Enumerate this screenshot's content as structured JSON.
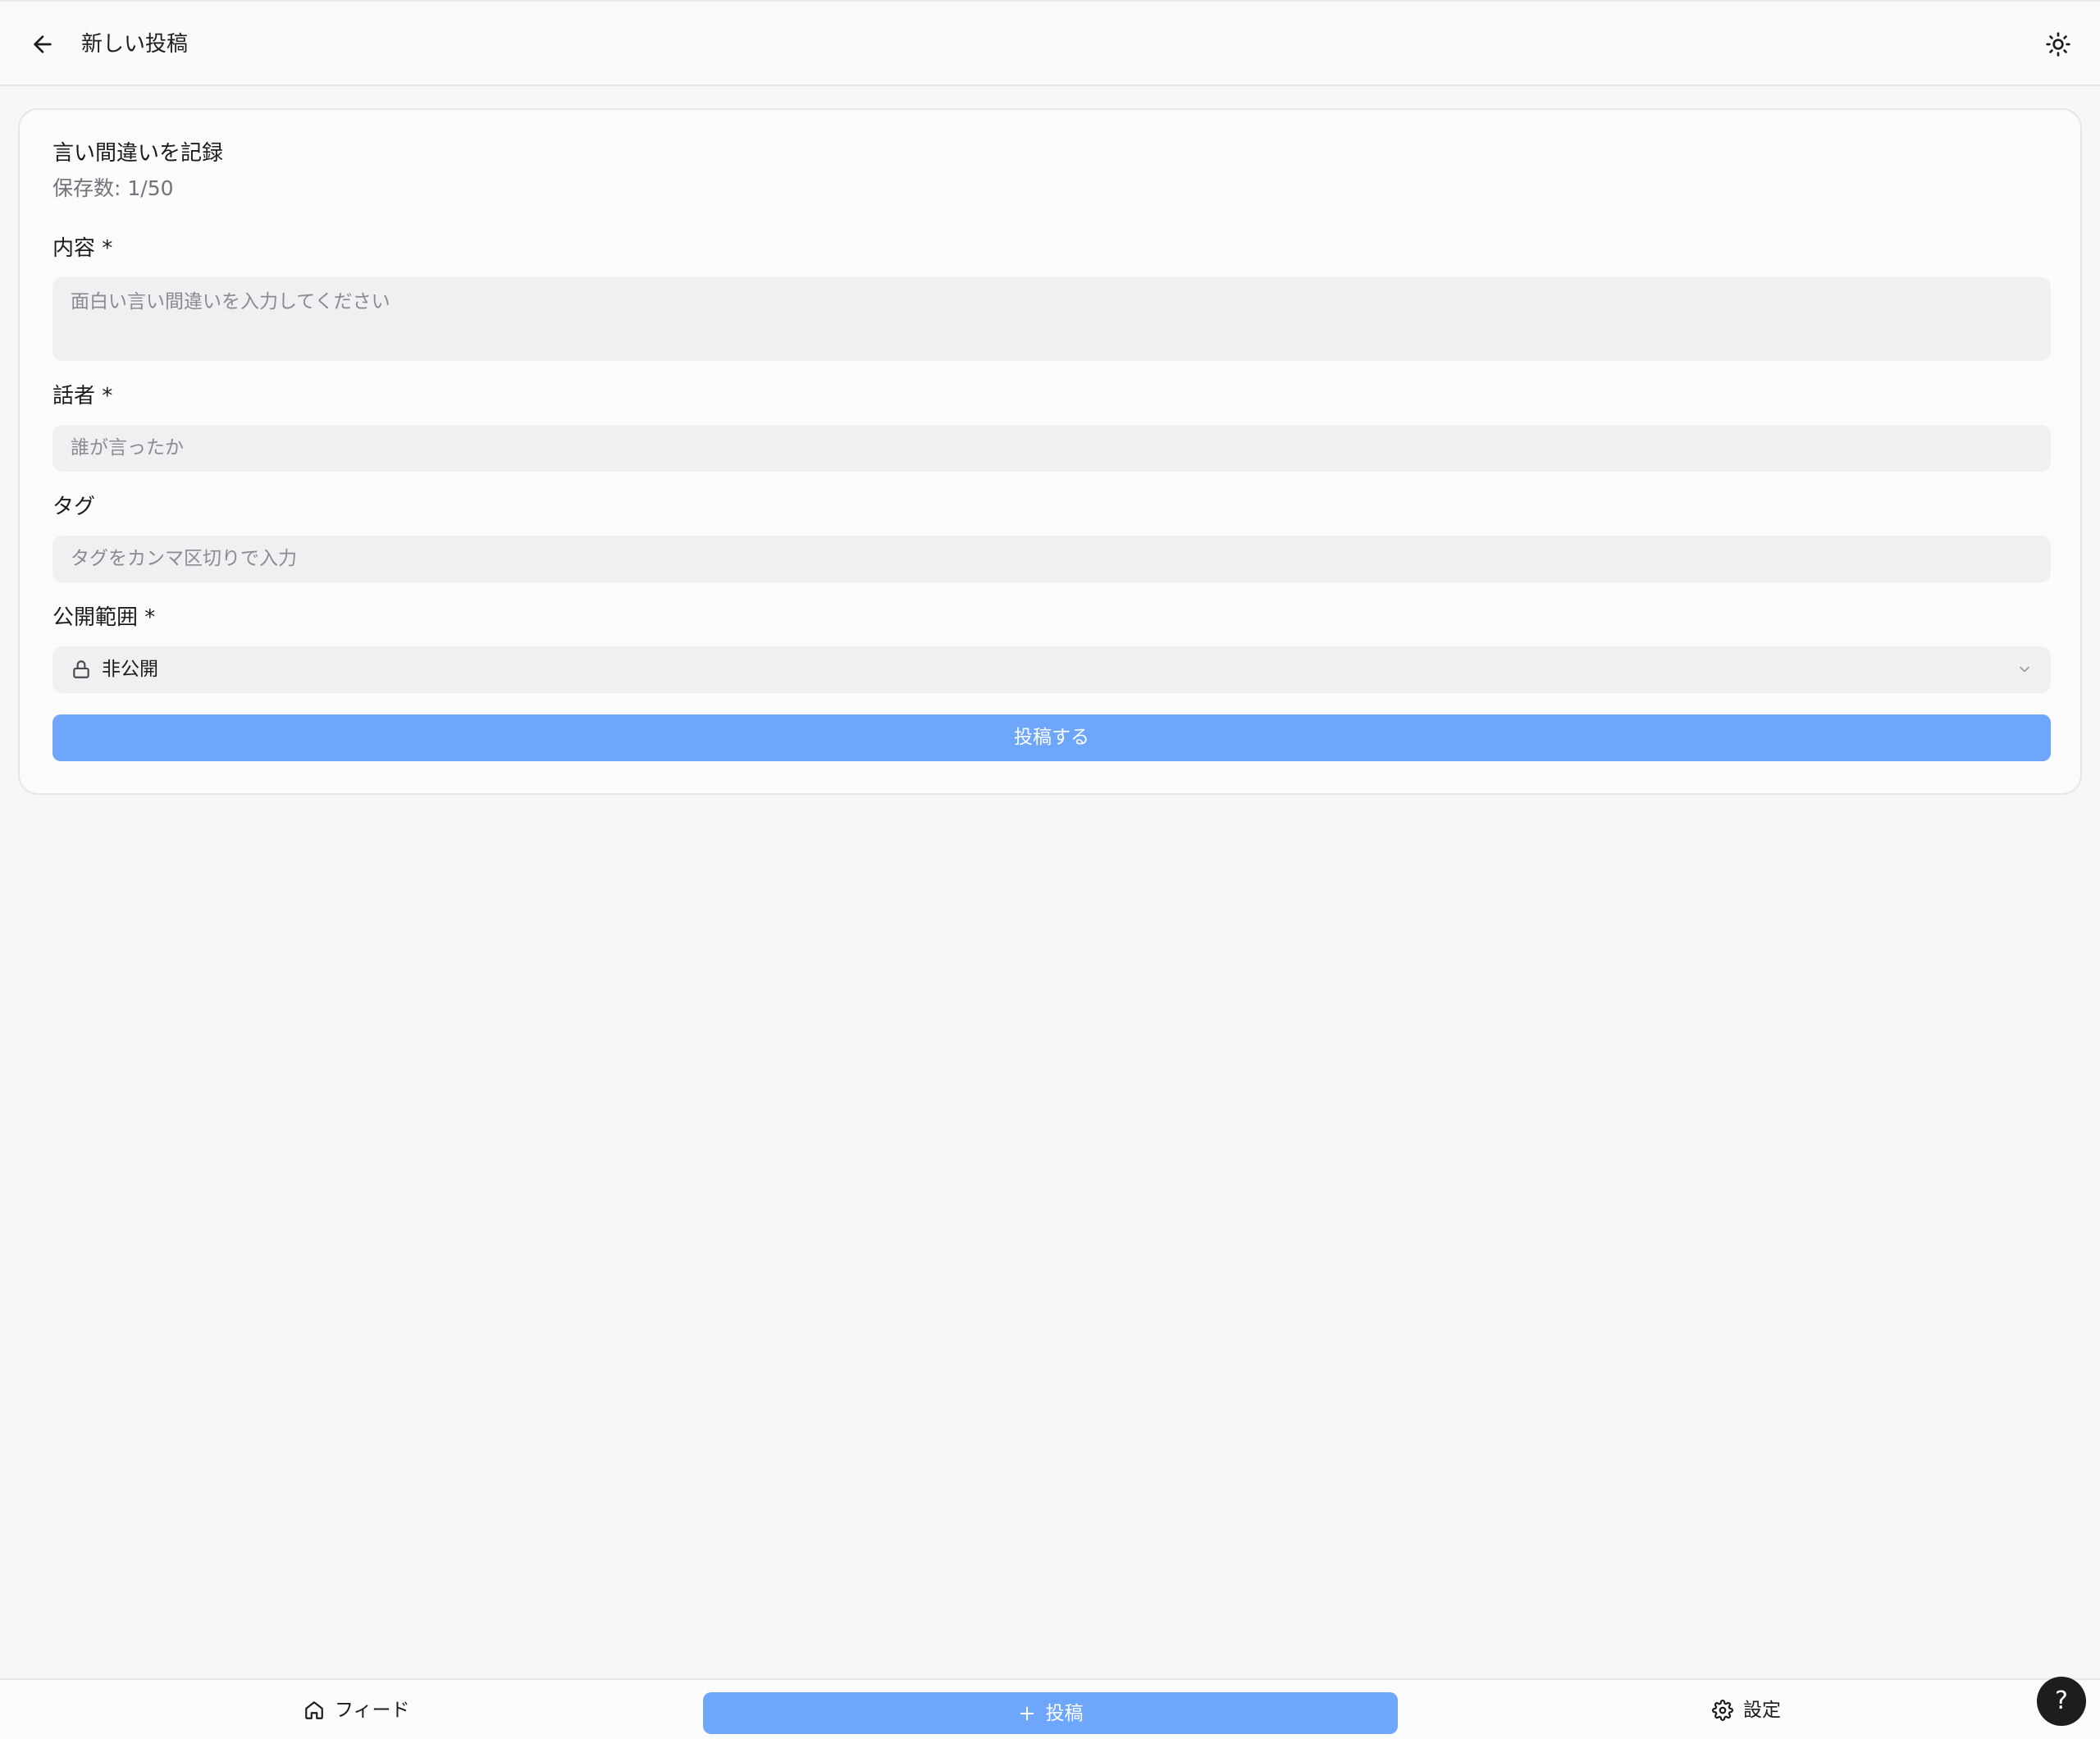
{
  "header": {
    "title": "新しい投稿",
    "back_icon": "arrow-left-icon",
    "theme_icon": "sun-icon"
  },
  "form": {
    "title": "言い間違いを記録",
    "saved_count": "保存数: 1/50",
    "content": {
      "label": "内容 *",
      "placeholder": "面白い言い間違いを入力してください",
      "value": ""
    },
    "speaker": {
      "label": "話者 *",
      "placeholder": "誰が言ったか",
      "value": ""
    },
    "tags": {
      "label": "タグ",
      "placeholder": "タグをカンマ区切りで入力",
      "value": ""
    },
    "visibility": {
      "label": "公開範囲 *",
      "selected": "非公開",
      "icon": "lock-icon"
    },
    "submit_label": "投稿する"
  },
  "bottom_nav": {
    "feed_label": "フィード",
    "post_label": "投稿",
    "settings_label": "設定"
  },
  "help": {
    "label": "?"
  },
  "colors": {
    "accent": "#6da6fb",
    "background": "#f7f7f7",
    "field_bg": "#f0f0f2",
    "help_bg": "#1d1d1f"
  }
}
